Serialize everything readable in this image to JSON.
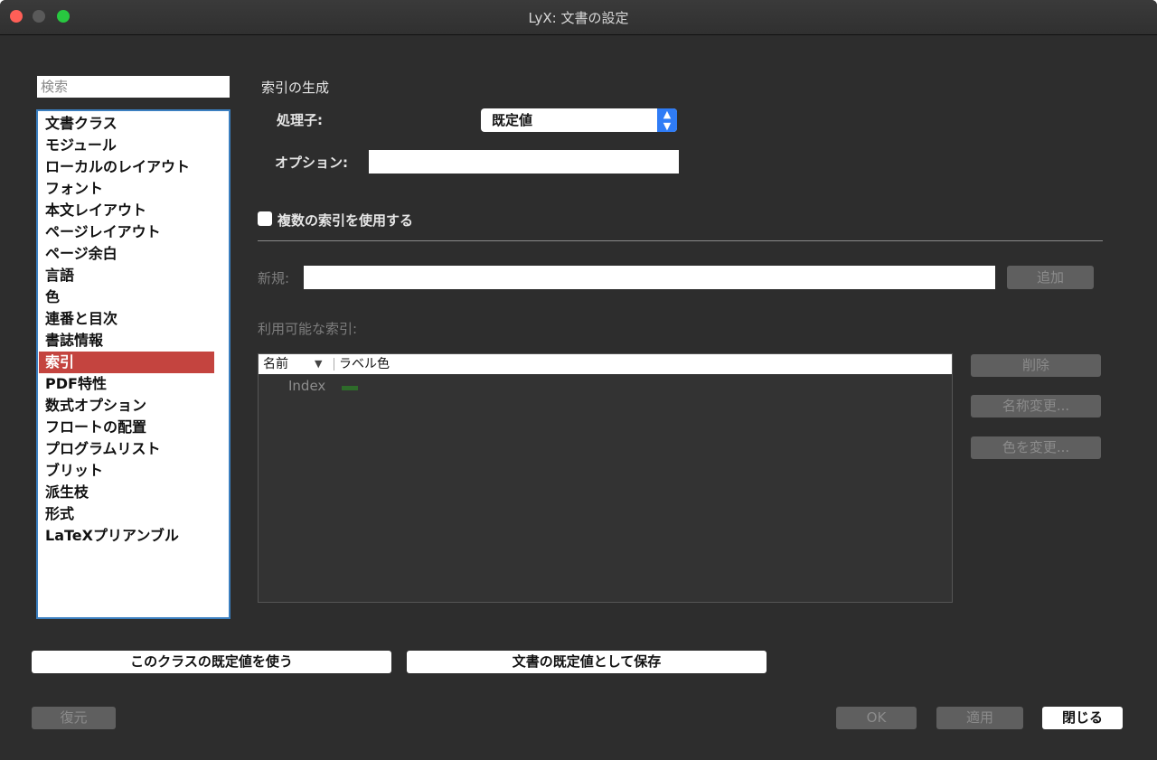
{
  "window": {
    "title": "LyX: 文書の設定"
  },
  "sidebar": {
    "search_placeholder": "検索",
    "items": [
      {
        "label": "文書クラス"
      },
      {
        "label": "モジュール"
      },
      {
        "label": "ローカルのレイアウト"
      },
      {
        "label": "フォント"
      },
      {
        "label": "本文レイアウト"
      },
      {
        "label": "ページレイアウト"
      },
      {
        "label": "ページ余白"
      },
      {
        "label": "言語"
      },
      {
        "label": "色"
      },
      {
        "label": "連番と目次"
      },
      {
        "label": "書誌情報"
      },
      {
        "label": "索引",
        "selected": true
      },
      {
        "label": "PDF特性"
      },
      {
        "label": "数式オプション"
      },
      {
        "label": "フロートの配置"
      },
      {
        "label": "プログラムリスト"
      },
      {
        "label": "ブリット"
      },
      {
        "label": "派生枝"
      },
      {
        "label": "形式"
      },
      {
        "label": "LaTeXプリアンブル"
      }
    ]
  },
  "index_panel": {
    "section_title": "索引の生成",
    "processor_label": "処理子:",
    "processor_value": "既定値",
    "options_label": "オプション:",
    "options_value": "",
    "multiple_indices_label": "複数の索引を使用する",
    "multiple_indices_checked": false,
    "new_label": "新規:",
    "new_value": "",
    "add_button": "追加",
    "available_label": "利用可能な索引:",
    "table": {
      "col_name": "名前",
      "sort_icon": "sort-down-triangle",
      "col_color": "ラベル色",
      "rows": [
        {
          "name": "Index",
          "color": "#2e6b2a"
        }
      ]
    },
    "delete_button": "削除",
    "rename_button": "名称変更...",
    "change_color_button": "色を変更..."
  },
  "footer": {
    "use_class_defaults": "このクラスの既定値を使う",
    "save_as_defaults": "文書の既定値として保存",
    "restore": "復元",
    "ok": "OK",
    "apply": "適用",
    "close": "閉じる"
  }
}
